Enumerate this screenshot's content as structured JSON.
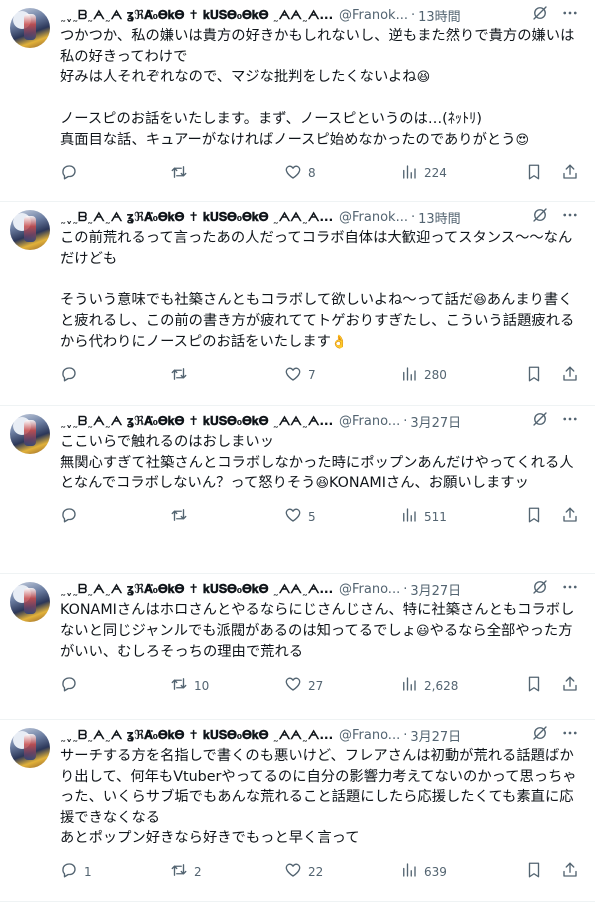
{
  "icons": {
    "grok": "grok-icon",
    "more": "more-icon",
    "reply": "reply-icon",
    "retweet": "retweet-icon",
    "like": "like-icon",
    "views": "views-icon",
    "bookmark": "bookmark-icon",
    "share": "share-icon"
  },
  "colors": {
    "text": "#0f1419",
    "muted": "#536471",
    "divider": "#eff3f4"
  },
  "tweets": [
    {
      "display_name": "˷ˬ˷ᗷ˷ᗅ˷ᗅ ʓℜ𝐀̈₀𝚯𝐤𝚯 ✝ 𝐤𝐔𝐒𝚯₀𝚯𝐤𝚯 ˷ᗅᗅ˷ᗅ...",
      "handle": "@Franok...",
      "time": "13時間",
      "body_1": "つかつか、私の嫌いは貴方の好きかもしれないし、逆もまた然りで貴方の嫌いは私の好きってわけで\n好みは人それぞれなので、マジな批判をしたくないよね",
      "emoji_1": "😆",
      "body_2": "\n\nノースピのお話をいたします。まず、ノースピというのは…(ﾈｯﾄﾘ)\n真面目な話、キュアーがなければノースピ始めなかったのでありがとう",
      "emoji_2": "😍",
      "body_3": "",
      "replies": "",
      "retweets": "",
      "likes": "8",
      "views": "224"
    },
    {
      "display_name": "˷ˬ˷ᗷ˷ᗅ˷ᗅ ʓℜ𝐀̈₀𝚯𝐤𝚯 ✝ 𝐤𝐔𝐒𝚯₀𝚯𝐤𝚯 ˷ᗅᗅ˷ᗅ...",
      "handle": "@Franok...",
      "time": "13時間",
      "body_1": "この前荒れるって言ったあの人だってコラボ自体は大歓迎ってスタンス～～なんだけども\n\nそういう意味でも社築さんともコラボして欲しいよね～って話だ",
      "emoji_1": "😆",
      "body_2": "あんまり書くと疲れるし、この前の書き方が疲れててトゲおりすぎたし、こういう話題疲れるから代わりにノースピのお話をいたします",
      "emoji_2": "👌",
      "body_3": "",
      "replies": "",
      "retweets": "",
      "likes": "7",
      "views": "280"
    },
    {
      "display_name": "˷ˬ˷ᗷ˷ᗅ˷ᗅ ʓℜ𝐀̈₀𝚯𝐤𝚯 ✝ 𝐤𝐔𝐒𝚯₀𝚯𝐤𝚯 ˷ᗅᗅ˷ᗅ...",
      "handle": "@Frano...",
      "time": "3月27日",
      "body_1": "ここいらで触れるのはおしまいッ\n無関心すぎて社築さんとコラボしなかった時にポップンあんだけやってくれる人となんでコラボしないん？って怒りそう",
      "emoji_1": "😆",
      "body_2": "KONAMIさん、お願いしますッ",
      "emoji_2": "",
      "body_3": "",
      "replies": "",
      "retweets": "",
      "likes": "5",
      "views": "511"
    },
    {
      "display_name": "˷ˬ˷ᗷ˷ᗅ˷ᗅ ʓℜ𝐀̈₀𝚯𝐤𝚯 ✝ 𝐤𝐔𝐒𝚯₀𝚯𝐤𝚯 ˷ᗅᗅ˷ᗅ...",
      "handle": "@Frano...",
      "time": "3月27日",
      "body_1": "KONAMIさんはホロさんとやるならにじさんじさん、特に社築さんともコラボしないと同じジャンルでも派閥があるのは知ってるでしょ",
      "emoji_1": "😃",
      "body_2": "やるなら全部やった方がいい、むしろそっちの理由で荒れる",
      "emoji_2": "",
      "body_3": "",
      "replies": "",
      "retweets": "10",
      "likes": "27",
      "views": "2,628"
    },
    {
      "display_name": "˷ˬ˷ᗷ˷ᗅ˷ᗅ ʓℜ𝐀̈₀𝚯𝐤𝚯 ✝ 𝐤𝐔𝐒𝚯₀𝚯𝐤𝚯 ˷ᗅᗅ˷ᗅ...",
      "handle": "@Frano...",
      "time": "3月27日",
      "body_1": "サーチする方を名指しで書くのも悪いけど、フレアさんは初動が荒れる話題ばかり出して、何年もVtuberやってるのに自分の影響力考えてないのかって思っちゃった、いくらサブ垢でもあんな荒れること話題にしたら応援したくても素直に応援できなくなる\nあとポップン好きなら好きでもっと早く言って",
      "emoji_1": "",
      "body_2": "",
      "emoji_2": "",
      "body_3": "",
      "replies": "1",
      "retweets": "2",
      "likes": "22",
      "views": "639"
    }
  ]
}
